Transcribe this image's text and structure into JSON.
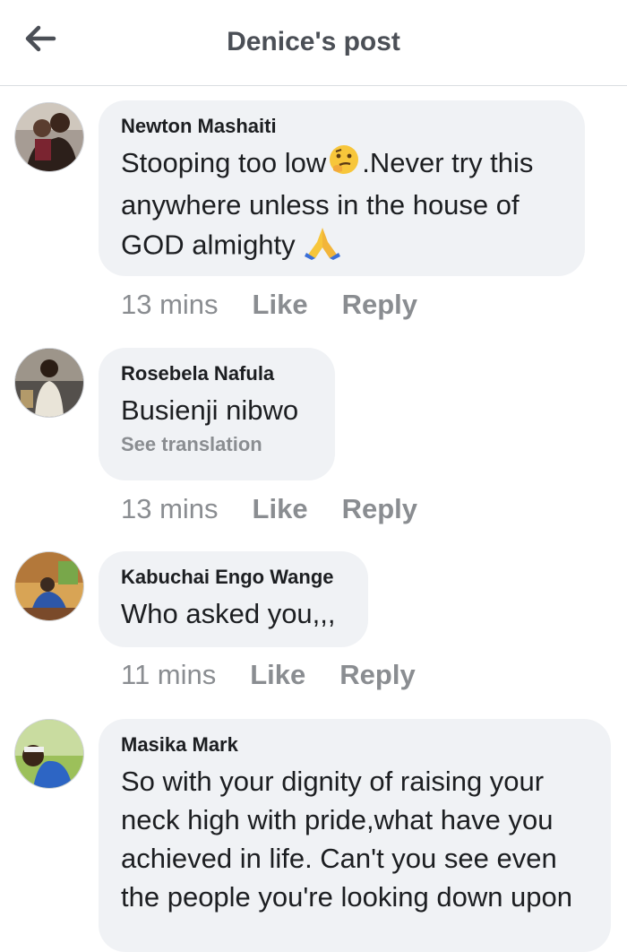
{
  "header": {
    "title": "Denice's post",
    "back_icon": "arrow-left-icon"
  },
  "comments": [
    {
      "author": "Newton Mashaiti",
      "text_part1": "Stooping too low",
      "emoji1": "thinking-face-emoji",
      "text_part2": ".Never try this anywhere unless in the house of GOD almighty",
      "emoji2": "folded-hands-emoji",
      "time": "13 mins",
      "like": "Like",
      "reply": "Reply"
    },
    {
      "author": "Rosebela Nafula",
      "text": "Busienji nibwo",
      "see_translation": "See translation",
      "time": "13 mins",
      "like": "Like",
      "reply": "Reply"
    },
    {
      "author": "Kabuchai Engo Wange",
      "text": "Who asked you,,,",
      "time": "11 mins",
      "like": "Like",
      "reply": "Reply"
    },
    {
      "author": "Masika Mark",
      "text": "So with your dignity of raising your neck high with pride,what have you achieved in life. Can't you see even the people you're looking down upon"
    }
  ],
  "colors": {
    "bubble": "#f0f2f5",
    "meta": "#8a8d91",
    "title": "#4b4f56"
  }
}
